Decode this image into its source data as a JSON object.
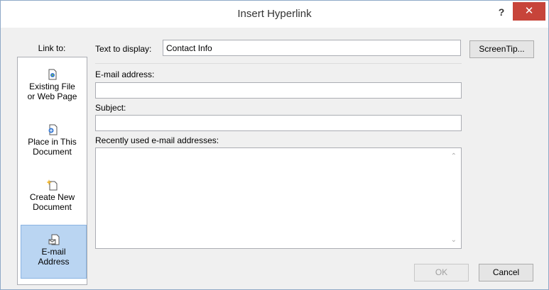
{
  "window": {
    "title": "Insert Hyperlink",
    "help_label": "?",
    "close_label": "✕"
  },
  "link_to": {
    "label": "Link to:",
    "items": [
      {
        "line1": "Existing File",
        "line2": "or Web Page",
        "icon": "existing-file-icon",
        "selected": false
      },
      {
        "line1": "Place in This",
        "line2": "Document",
        "icon": "place-in-document-icon",
        "selected": false
      },
      {
        "line1": "Create New",
        "line2": "Document",
        "icon": "create-new-document-icon",
        "selected": false
      },
      {
        "line1": "E-mail",
        "line2": "Address",
        "icon": "email-address-icon",
        "selected": true
      }
    ]
  },
  "text_to_display": {
    "label": "Text to display:",
    "value": "Contact Info"
  },
  "screentip_label": "ScreenTip...",
  "email": {
    "label": "E-mail address:",
    "value": ""
  },
  "subject": {
    "label": "Subject:",
    "value": ""
  },
  "recent": {
    "label": "Recently used e-mail addresses:"
  },
  "buttons": {
    "ok": "OK",
    "cancel": "Cancel"
  },
  "colors": {
    "accent": "#bad5f2",
    "close": "#c7443a"
  }
}
